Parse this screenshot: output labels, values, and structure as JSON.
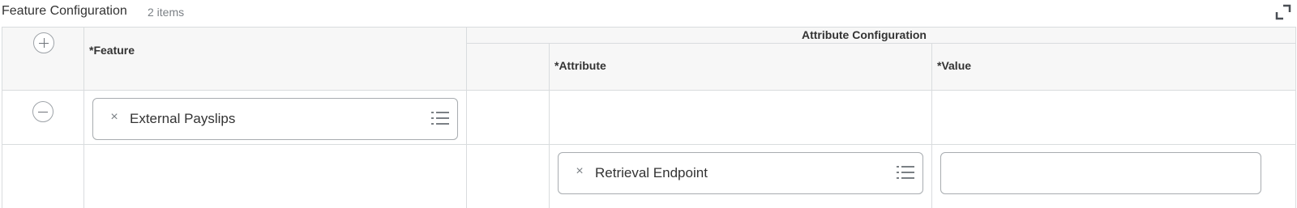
{
  "header": {
    "title": "Feature Configuration",
    "count": "2 items",
    "expand_icon": "expand-icon"
  },
  "table": {
    "add_icon": "plus-circle-icon",
    "columns": {
      "feature": "*Feature",
      "group": "Attribute Configuration",
      "attribute": "*Attribute",
      "value": "*Value"
    },
    "rows": [
      {
        "remove_icon": "minus-circle-icon",
        "feature": "External Payslips",
        "attribute": "",
        "value": ""
      },
      {
        "feature": "",
        "attribute": "Retrieval Endpoint",
        "value": ""
      }
    ]
  },
  "icons": {
    "clear": "×",
    "prompt": "list-icon"
  }
}
